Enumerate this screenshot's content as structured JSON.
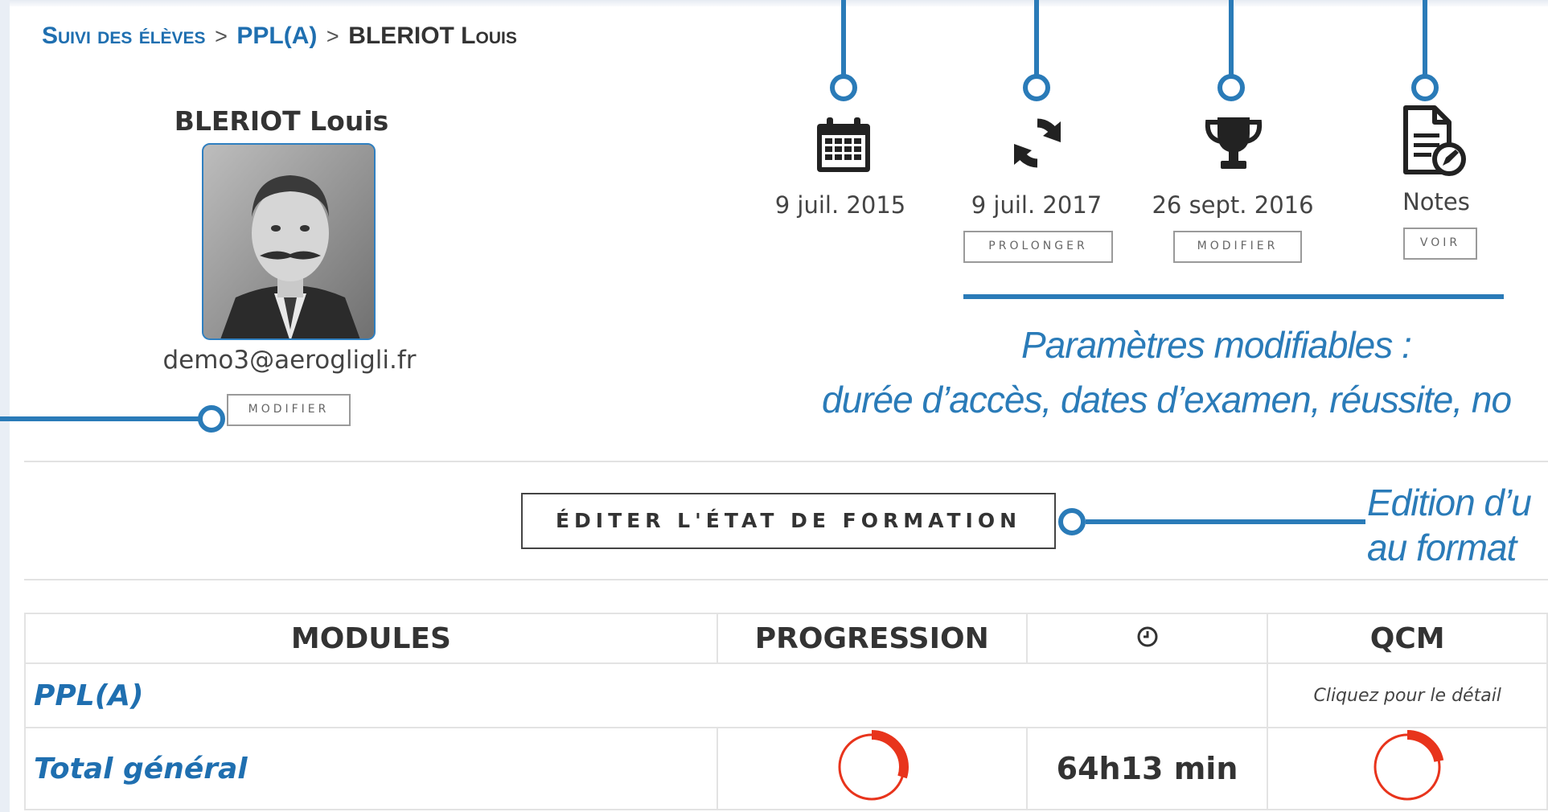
{
  "breadcrumb": {
    "root": "Suivi des élèves",
    "course": "PPL(A)",
    "student": "BLERIOT Louis",
    "separator": ">"
  },
  "student": {
    "name": "BLERIOT Louis",
    "email": "demo3@aerogligli.fr",
    "modify_label": "MODIFIER"
  },
  "params": [
    {
      "icon": "calendar-icon",
      "value": "9 juil. 2015"
    },
    {
      "icon": "refresh-icon",
      "value": "9 juil. 2017",
      "button": "PROLONGER"
    },
    {
      "icon": "trophy-icon",
      "value": "26 sept. 2016",
      "button": "MODIFIER"
    },
    {
      "icon": "notes-icon",
      "value": "Notes",
      "button": "VOIR"
    }
  ],
  "annotations": {
    "params_title": "Paramètres modifiables :",
    "params_detail": "durée d’accès, dates d’examen, réussite, no",
    "edit_line1": "Edition d’u",
    "edit_line2": "au format"
  },
  "edit_button": "ÉDITER L'ÉTAT DE FORMATION",
  "table": {
    "headers": [
      "MODULES",
      "PROGRESSION",
      "clock-icon",
      "QCM"
    ],
    "rows": [
      {
        "module": "PPL(A)",
        "qcm_hint": "Cliquez pour le détail"
      },
      {
        "module": "Total général",
        "time": "64h13 min",
        "progression_fraction": 0.3,
        "qcm_fraction": 0.22
      }
    ]
  },
  "colors": {
    "accent": "#2a7bb8",
    "link": "#1f6fb0",
    "progress_red": "#e8341c"
  }
}
